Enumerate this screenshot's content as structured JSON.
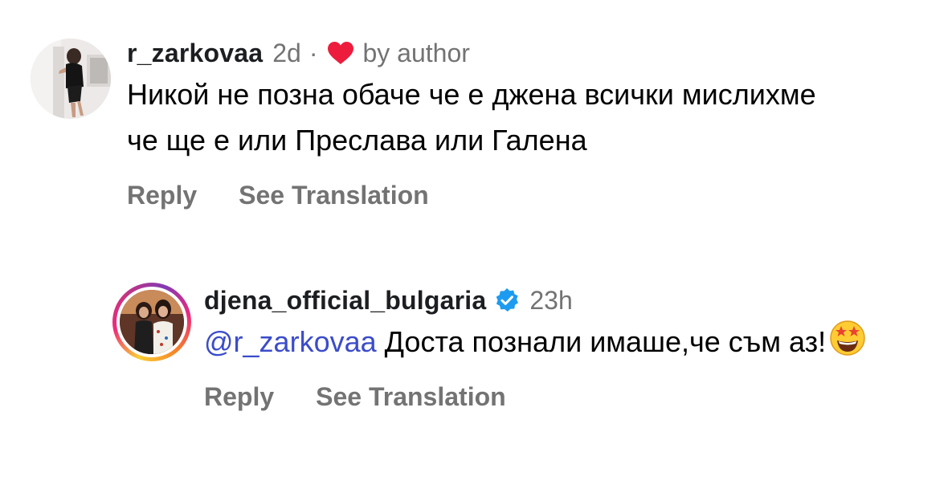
{
  "comments": [
    {
      "username": "r_zarkovaa",
      "time": "2d",
      "separator": "·",
      "liked_by_author_label": "by author",
      "text": "Никой не позна обаче че е джена всички мислихме че ще е или Преслава или Галена",
      "reply_label": "Reply",
      "translate_label": "See Translation"
    },
    {
      "username": "djena_official_bulgaria",
      "verified": true,
      "time": "23h",
      "mention": "@r_zarkovaa",
      "text": " Доста познали имаше,че съм аз!",
      "emoji": "star-struck-emoji-icon",
      "reply_label": "Reply",
      "translate_label": "See Translation"
    }
  ],
  "colors": {
    "heart": "#ed1c3c",
    "verified": "#1d9bf0",
    "mention": "#3b4cca",
    "secondary_text": "#737373"
  }
}
